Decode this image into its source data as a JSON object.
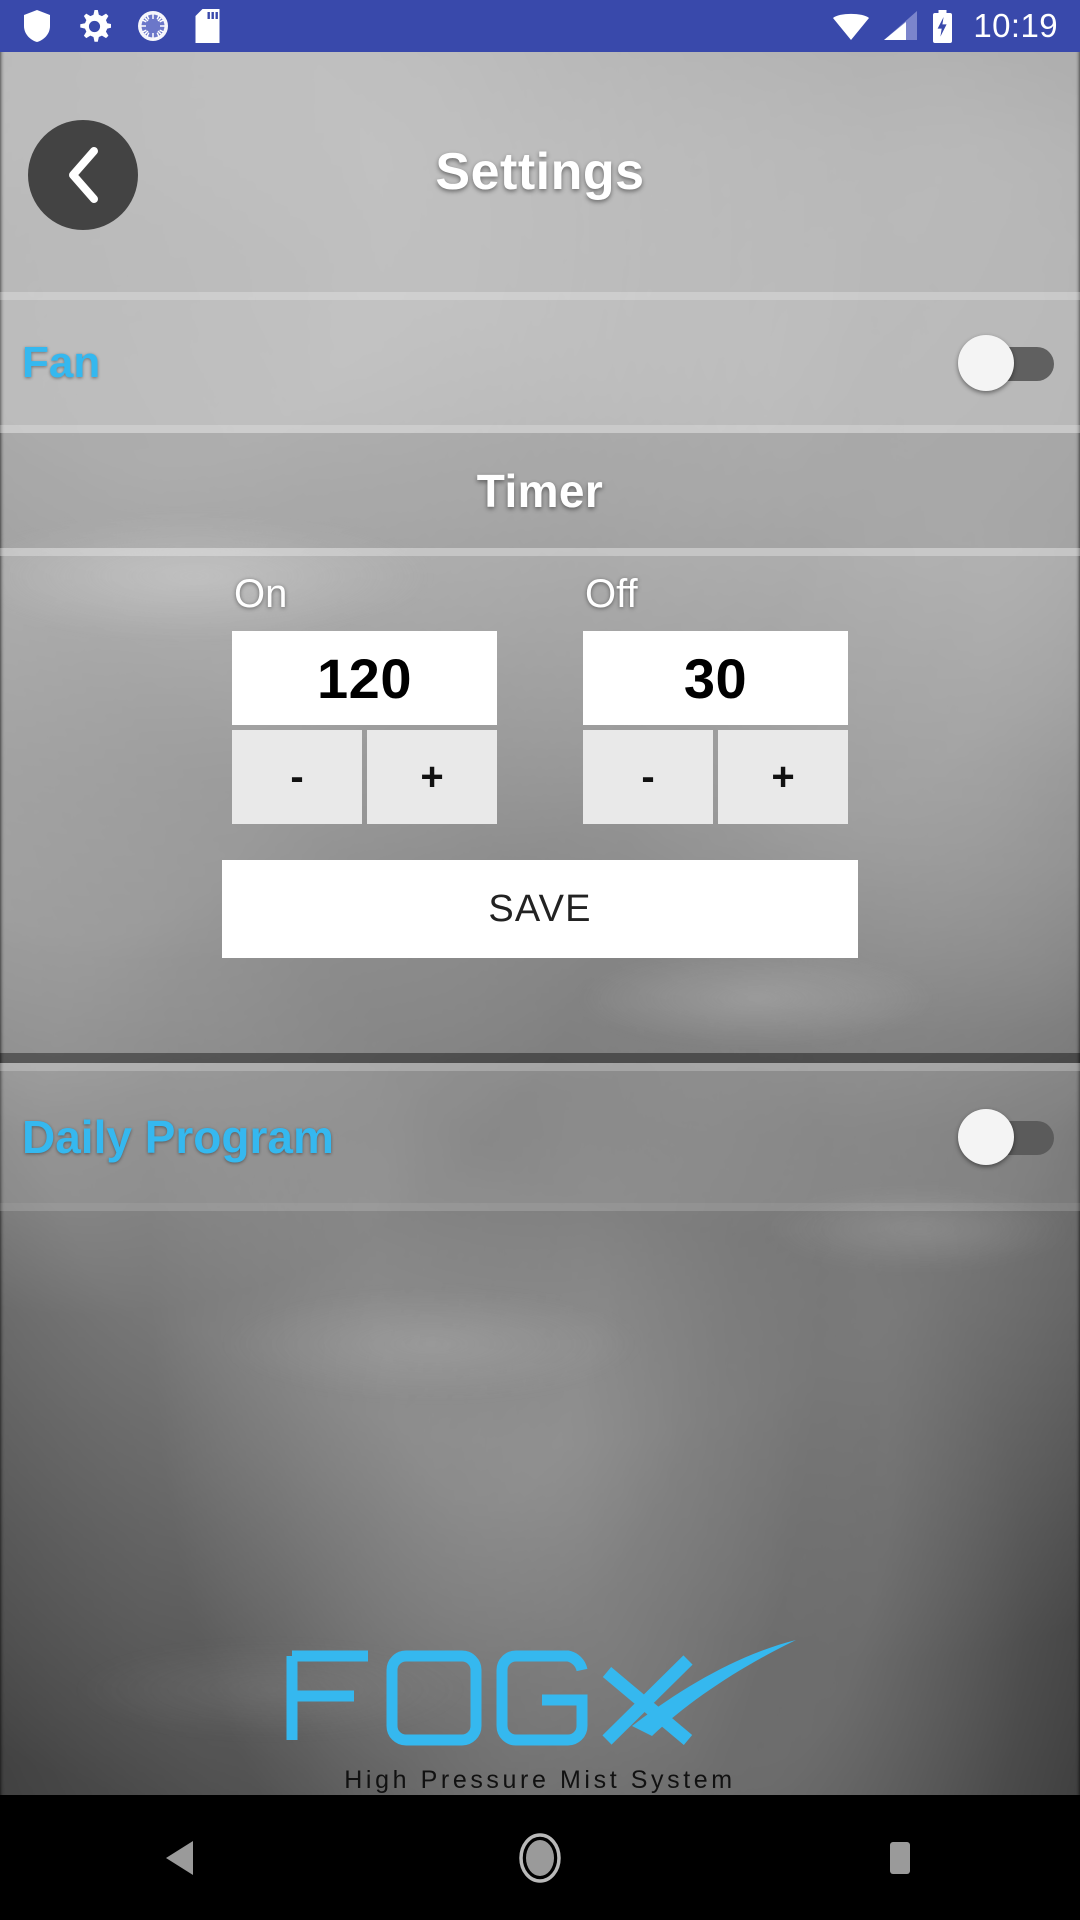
{
  "status_bar": {
    "icons_left": [
      "shield-icon",
      "gear-icon",
      "dial-icon",
      "sd-card-icon"
    ],
    "icons_right": [
      "wifi-icon",
      "cellular-signal-icon",
      "battery-charging-icon"
    ],
    "clock": "10:19",
    "background_color": "#3949ab"
  },
  "header": {
    "title": "Settings",
    "back_icon": "chevron-left-icon"
  },
  "accent_color": "#35b8ef",
  "rows": {
    "fan": {
      "label": "Fan",
      "toggle_state": "off"
    },
    "daily_program": {
      "label": "Daily Program",
      "toggle_state": "off"
    }
  },
  "timer": {
    "heading": "Timer",
    "fields": [
      {
        "caption": "On",
        "value": "120",
        "decrement_label": "-",
        "increment_label": "+"
      },
      {
        "caption": "Off",
        "value": "30",
        "decrement_label": "-",
        "increment_label": "+"
      }
    ],
    "save_label": "SAVE"
  },
  "logo": {
    "wordmark": "FOGX",
    "tagline": "High Pressure Mist System",
    "color": "#35b8ef"
  },
  "nav_bar": {
    "back_icon": "nav-back-triangle-icon",
    "home_icon": "nav-home-circle-icon",
    "recents_icon": "nav-recents-square-icon"
  }
}
